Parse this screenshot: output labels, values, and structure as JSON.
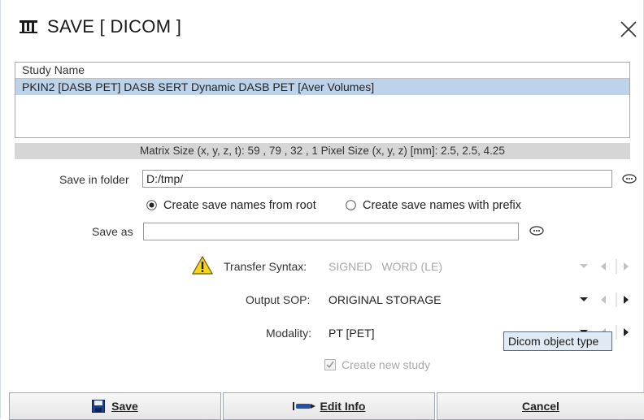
{
  "window": {
    "title": "SAVE [ DICOM ]",
    "icons": {
      "app": "pmod-icon",
      "close": "close-icon"
    }
  },
  "study_table": {
    "column_header": "Study Name",
    "rows": [
      "PKIN2 [DASB PET] DASB SERT Dynamic DASB PET [Aver Volumes]"
    ]
  },
  "info_bar": "Matrix Size (x, y, z, t): 59 , 79 , 32 , 1   Pixel Size (x, y, z) [mm]: 2.5, 2.5, 4.25",
  "save_in_folder": {
    "label": "Save in folder",
    "value": "D:/tmp/"
  },
  "naming": {
    "options": [
      "Create save names from root",
      "Create save names with prefix"
    ],
    "selected": "Create save names from root"
  },
  "save_as": {
    "label": "Save as",
    "value": ""
  },
  "transfer_syntax": {
    "label": "Transfer Syntax:",
    "value": "SIGNED   WORD (LE)",
    "enabled": false
  },
  "output_sop": {
    "label": "Output SOP:",
    "value": "ORIGINAL STORAGE",
    "enabled": true
  },
  "modality": {
    "label": "Modality:",
    "value": "PT [PET]",
    "enabled": true
  },
  "tooltip": "Dicom object type",
  "create_new_study": {
    "label": "Create new study",
    "checked": true,
    "enabled": false
  },
  "buttons": {
    "save": "Save",
    "edit_info": "Edit Info",
    "cancel": "Cancel"
  },
  "colors": {
    "selection": "#bcd3ea",
    "info_bar": "#d6d6d6",
    "tooltip_bg": "#e0eaf5",
    "disabled_text": "#a9a9a9"
  }
}
